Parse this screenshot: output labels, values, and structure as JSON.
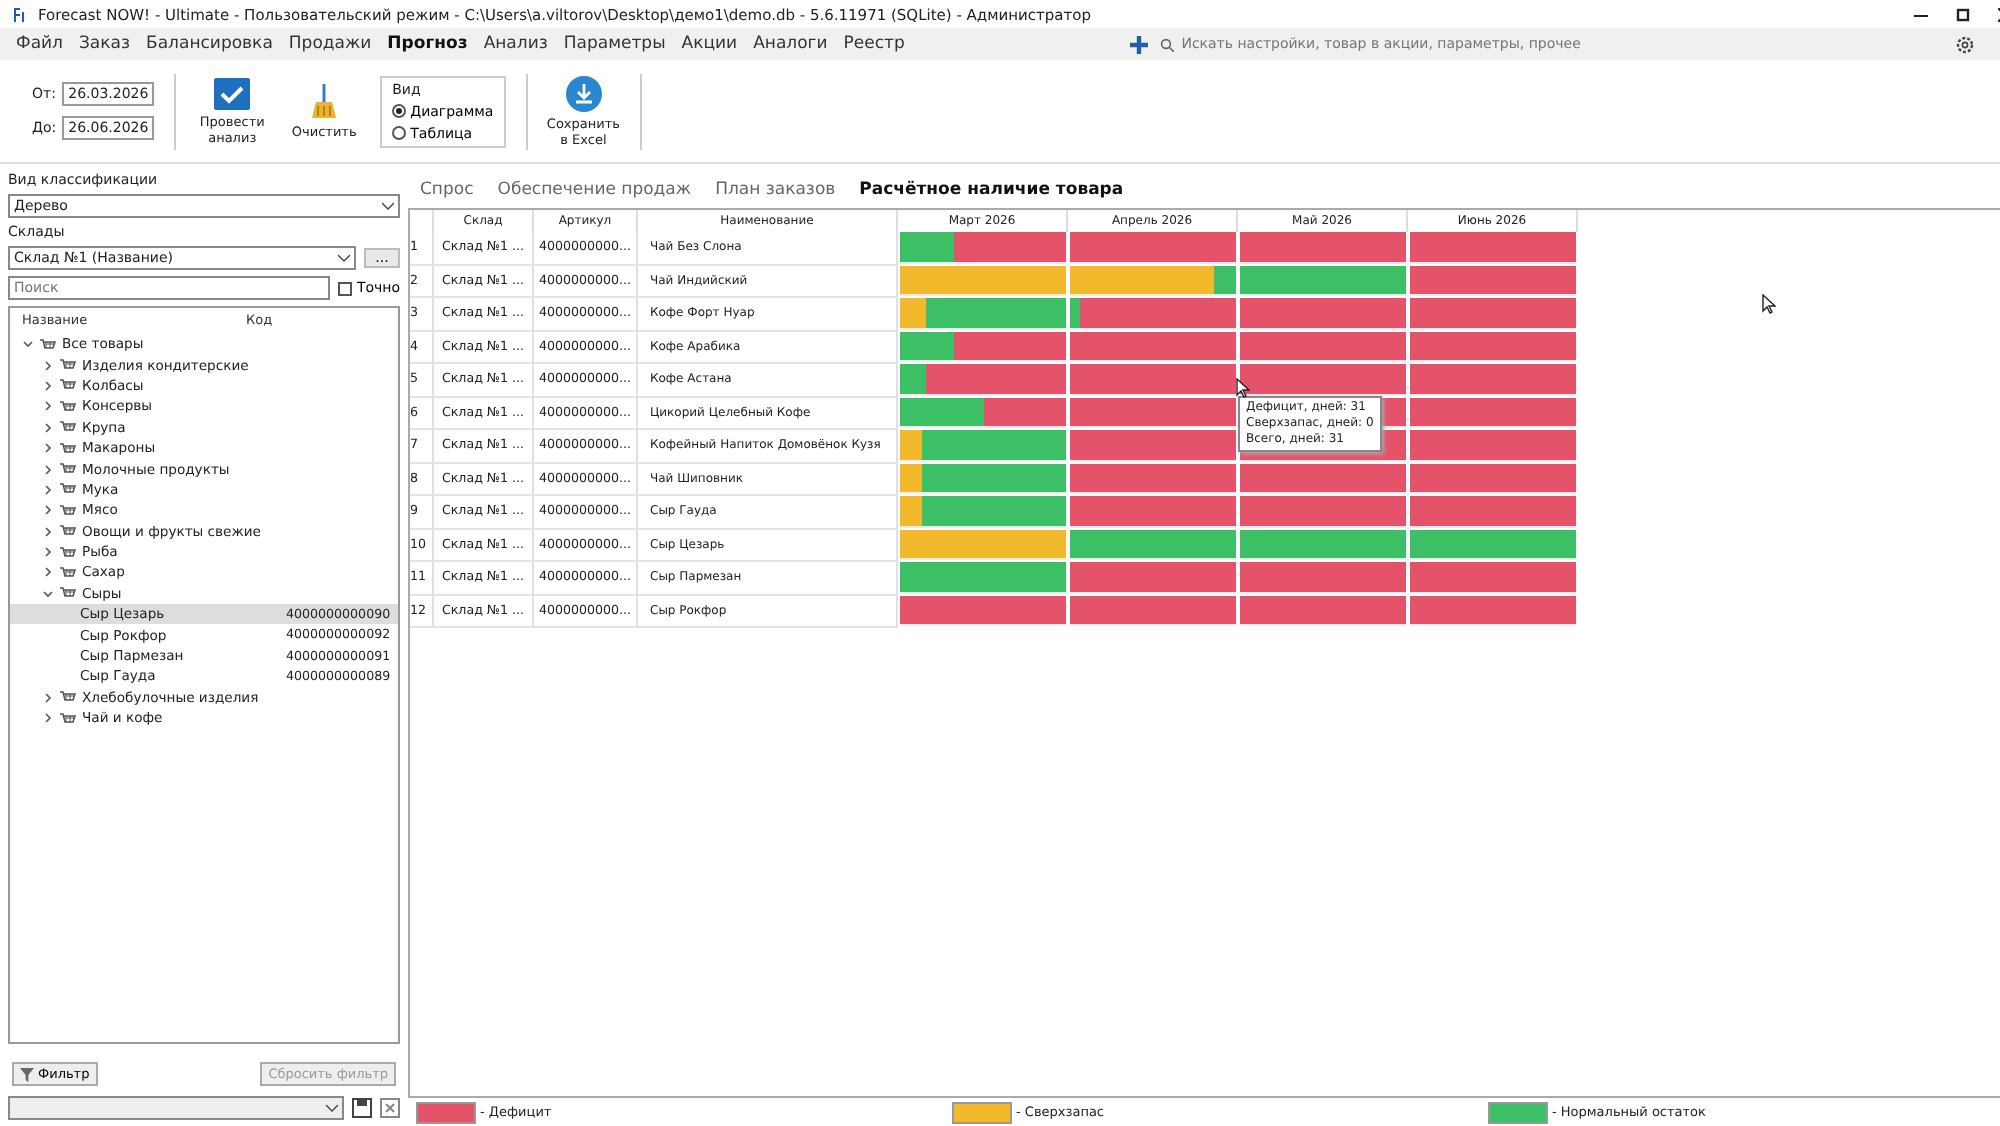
{
  "window": {
    "title": "Forecast NOW! - Ultimate - Пользовательский режим - C:\\Users\\a.viltorov\\Desktop\\демо1\\demo.db - 5.6.11971 (SQLite) - Администратор"
  },
  "menu": [
    {
      "label": "Файл",
      "selected": false
    },
    {
      "label": "Заказ",
      "selected": false
    },
    {
      "label": "Балансировка",
      "selected": false
    },
    {
      "label": "Продажи",
      "selected": false
    },
    {
      "label": "Прогноз",
      "selected": true
    },
    {
      "label": "Анализ",
      "selected": false
    },
    {
      "label": "Параметры",
      "selected": false
    },
    {
      "label": "Акции",
      "selected": false
    },
    {
      "label": "Аналоги",
      "selected": false
    },
    {
      "label": "Реестр",
      "selected": false
    }
  ],
  "search": {
    "placeholder": "Искать настройки, товар в акции, параметры, прочее"
  },
  "toolbar": {
    "from_label": "От:",
    "from": "26.03.2026",
    "to_label": "До:",
    "to": "26.06.2026",
    "analyze": "Провести анализ",
    "clear": "Очистить",
    "view_group": "Вид",
    "view_options": [
      {
        "label": "Диаграмма",
        "selected": true
      },
      {
        "label": "Таблица",
        "selected": false
      }
    ],
    "export": "Сохранить в Excel"
  },
  "sidebar": {
    "classification_label": "Вид классификации",
    "classification": "Дерево",
    "warehouses_label": "Склады",
    "warehouse": "Склад №1 (Название)",
    "more": "...",
    "search_placeholder": "Поиск",
    "exact_label": "Точно",
    "exact": false,
    "tree_columns": [
      "Название",
      "Код"
    ],
    "tree": [
      {
        "name": "Все товары",
        "expanded": true,
        "children": [
          {
            "name": "Изделия кондитерские",
            "expanded": false
          },
          {
            "name": "Колбасы",
            "expanded": false
          },
          {
            "name": "Консервы",
            "expanded": false
          },
          {
            "name": "Крупа",
            "expanded": false
          },
          {
            "name": "Макароны",
            "expanded": false
          },
          {
            "name": "Молочные продукты",
            "expanded": false
          },
          {
            "name": "Мука",
            "expanded": false
          },
          {
            "name": "Мясо",
            "expanded": false
          },
          {
            "name": "Овощи и фрукты свежие",
            "expanded": false
          },
          {
            "name": "Рыба",
            "expanded": false
          },
          {
            "name": "Сахар",
            "expanded": false
          },
          {
            "name": "Сыры",
            "expanded": true,
            "children": [
              {
                "name": "Сыр Цезарь",
                "code": "4000000000090",
                "selected": true
              },
              {
                "name": "Сыр Рокфор",
                "code": "4000000000092",
                "selected": false
              },
              {
                "name": "Сыр Пармезан",
                "code": "4000000000091",
                "selected": false
              },
              {
                "name": "Сыр Гауда",
                "code": "4000000000089",
                "selected": false
              }
            ]
          },
          {
            "name": "Хлебобулочные изделия",
            "expanded": false
          },
          {
            "name": "Чай и кофе",
            "expanded": false
          }
        ]
      }
    ],
    "filter_button": "Фильтр",
    "reset_button": "Сбросить фильтр"
  },
  "tabs": [
    {
      "label": "Спрос",
      "selected": false
    },
    {
      "label": "Обеспечение продаж",
      "selected": false
    },
    {
      "label": "План заказов",
      "selected": false
    },
    {
      "label": "Расчётное наличие товара",
      "selected": true
    }
  ],
  "table": {
    "columns": [
      "Склад",
      "Артикул",
      "Наименование"
    ],
    "months": [
      "Март 2026",
      "Апрель 2026",
      "Май 2026",
      "Июнь 2026"
    ],
    "rows": [
      {
        "n": "1",
        "warehouse": "Склад №1 ...",
        "sku": "4000000000...",
        "name": "Чай Без Слона",
        "months": [
          [
            {
              "color": "#3cbf65",
              "level": 0.33
            },
            {
              "color": "#e5536b",
              "level": 0.67
            }
          ],
          [
            {
              "color": "#e5536b",
              "level": 1
            }
          ],
          [
            {
              "color": "#e5536b",
              "level": 1
            }
          ],
          [
            {
              "color": "#e5536b",
              "level": 1
            }
          ]
        ]
      },
      {
        "n": "2",
        "warehouse": "Склад №1 ...",
        "sku": "4000000000...",
        "name": "Чай Индийский",
        "months": [
          [
            {
              "color": "#f2b92d",
              "level": 1
            }
          ],
          [
            {
              "color": "#f2b92d",
              "level": 0.87
            },
            {
              "color": "#3cbf65",
              "level": 0.13
            }
          ],
          [
            {
              "color": "#3cbf65",
              "level": 1
            }
          ],
          [
            {
              "color": "#e5536b",
              "level": 1
            }
          ]
        ]
      },
      {
        "n": "3",
        "warehouse": "Склад №1 ...",
        "sku": "4000000000...",
        "name": "Кофе Форт Нуар",
        "months": [
          [
            {
              "color": "#f2b92d",
              "level": 0.16
            },
            {
              "color": "#3cbf65",
              "level": 0.84
            }
          ],
          [
            {
              "color": "#3cbf65",
              "level": 0.06
            },
            {
              "color": "#e5536b",
              "level": 0.94
            }
          ],
          [
            {
              "color": "#e5536b",
              "level": 1
            }
          ],
          [
            {
              "color": "#e5536b",
              "level": 1
            }
          ]
        ]
      },
      {
        "n": "4",
        "warehouse": "Склад №1 ...",
        "sku": "4000000000...",
        "name": "Кофе Арабика",
        "months": [
          [
            {
              "color": "#3cbf65",
              "level": 0.33
            },
            {
              "color": "#e5536b",
              "level": 0.67
            }
          ],
          [
            {
              "color": "#e5536b",
              "level": 1
            }
          ],
          [
            {
              "color": "#e5536b",
              "level": 1
            }
          ],
          [
            {
              "color": "#e5536b",
              "level": 1
            }
          ]
        ]
      },
      {
        "n": "5",
        "warehouse": "Склад №1 ...",
        "sku": "4000000000...",
        "name": "Кофе Астана",
        "months": [
          [
            {
              "color": "#3cbf65",
              "level": 0.16
            },
            {
              "color": "#e5536b",
              "level": 0.84
            }
          ],
          [
            {
              "color": "#e5536b",
              "level": 1
            }
          ],
          [
            {
              "color": "#e5536b",
              "level": 1
            }
          ],
          [
            {
              "color": "#e5536b",
              "level": 1
            }
          ]
        ]
      },
      {
        "n": "6",
        "warehouse": "Склад №1 ...",
        "sku": "4000000000...",
        "name": "Цикорий Целебный Кофе",
        "months": [
          [
            {
              "color": "#3cbf65",
              "level": 0.5
            },
            {
              "color": "#e5536b",
              "level": 0.5
            }
          ],
          [
            {
              "color": "#e5536b",
              "level": 1
            }
          ],
          [
            {
              "color": "#e5536b",
              "level": 1
            }
          ],
          [
            {
              "color": "#e5536b",
              "level": 1
            }
          ]
        ]
      },
      {
        "n": "7",
        "warehouse": "Склад №1 ...",
        "sku": "4000000000...",
        "name": "Кофейный Напиток Домовёнок Кузя",
        "months": [
          [
            {
              "color": "#f2b92d",
              "level": 0.13
            },
            {
              "color": "#3cbf65",
              "level": 0.87
            }
          ],
          [
            {
              "color": "#e5536b",
              "level": 1
            }
          ],
          [
            {
              "color": "#e5536b",
              "level": 1
            }
          ],
          [
            {
              "color": "#e5536b",
              "level": 1
            }
          ]
        ]
      },
      {
        "n": "8",
        "warehouse": "Склад №1 ...",
        "sku": "4000000000...",
        "name": "Чай Шиповник",
        "months": [
          [
            {
              "color": "#f2b92d",
              "level": 0.13
            },
            {
              "color": "#3cbf65",
              "level": 0.87
            }
          ],
          [
            {
              "color": "#e5536b",
              "level": 1
            }
          ],
          [
            {
              "color": "#e5536b",
              "level": 1
            }
          ],
          [
            {
              "color": "#e5536b",
              "level": 1
            }
          ]
        ]
      },
      {
        "n": "9",
        "warehouse": "Склад №1 ...",
        "sku": "4000000000...",
        "name": "Сыр Гауда",
        "months": [
          [
            {
              "color": "#f2b92d",
              "level": 0.13
            },
            {
              "color": "#3cbf65",
              "level": 0.87
            }
          ],
          [
            {
              "color": "#e5536b",
              "level": 1
            }
          ],
          [
            {
              "color": "#e5536b",
              "level": 1
            }
          ],
          [
            {
              "color": "#e5536b",
              "level": 1
            }
          ]
        ]
      },
      {
        "n": "10",
        "warehouse": "Склад №1 ...",
        "sku": "4000000000...",
        "name": "Сыр Цезарь",
        "months": [
          [
            {
              "color": "#f2b92d",
              "level": 1
            }
          ],
          [
            {
              "color": "#3cbf65",
              "level": 1
            }
          ],
          [
            {
              "color": "#3cbf65",
              "level": 1
            }
          ],
          [
            {
              "color": "#3cbf65",
              "level": 1
            }
          ]
        ]
      },
      {
        "n": "11",
        "warehouse": "Склад №1 ...",
        "sku": "4000000000...",
        "name": "Сыр Пармезан",
        "months": [
          [
            {
              "color": "#3cbf65",
              "level": 1
            }
          ],
          [
            {
              "color": "#e5536b",
              "level": 1
            }
          ],
          [
            {
              "color": "#e5536b",
              "level": 1
            }
          ],
          [
            {
              "color": "#e5536b",
              "level": 1
            }
          ]
        ]
      },
      {
        "n": "12",
        "warehouse": "Склад №1 ...",
        "sku": "4000000000...",
        "name": "Сыр Рокфор",
        "months": [
          [
            {
              "color": "#e5536b",
              "level": 1
            }
          ],
          [
            {
              "color": "#e5536b",
              "level": 1
            }
          ],
          [
            {
              "color": "#e5536b",
              "level": 1
            }
          ],
          [
            {
              "color": "#e5536b",
              "level": 1
            }
          ]
        ]
      }
    ]
  },
  "tooltip": [
    "Дефицит, дней: 31",
    "Сверхзапас, дней: 0",
    "Всего, дней: 31"
  ],
  "legend": [
    {
      "label": "- Дефицит",
      "color": "#e5536b"
    },
    {
      "label": "- Сверхзапас",
      "color": "#f2b92d"
    },
    {
      "label": "- Нормальный остаток",
      "color": "#3cbf65"
    }
  ]
}
